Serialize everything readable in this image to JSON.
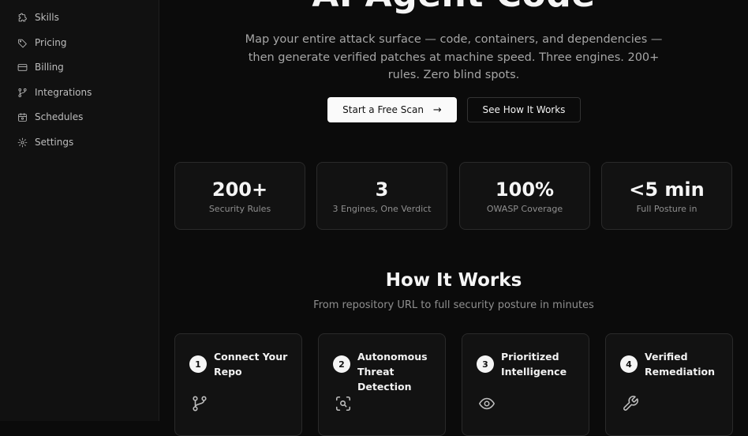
{
  "sidebar": {
    "items": [
      {
        "label": "Skills",
        "icon": "puzzle-icon"
      },
      {
        "label": "Pricing",
        "icon": "tag-icon"
      },
      {
        "label": "Billing",
        "icon": "credit-card-icon"
      },
      {
        "label": "Integrations",
        "icon": "git-branch-icon"
      },
      {
        "label": "Schedules",
        "icon": "calendar-icon"
      },
      {
        "label": "Settings",
        "icon": "gear-icon"
      }
    ]
  },
  "hero": {
    "title": "AI Agent Code",
    "subtitle": "Map your entire attack surface — code, containers, and dependencies — then generate verified patches at machine speed. Three engines. 200+ rules. Zero blind spots.",
    "primary_button": "Start a Free Scan",
    "secondary_button": "See How It Works"
  },
  "stats": [
    {
      "value": "200+",
      "label": "Security Rules"
    },
    {
      "value": "3",
      "label": "3 Engines, One Verdict"
    },
    {
      "value": "100%",
      "label": "OWASP Coverage"
    },
    {
      "value": "<5 min",
      "label": "Full Posture in"
    }
  ],
  "how_it_works": {
    "title": "How It Works",
    "subtitle": "From repository URL to full security posture in minutes",
    "steps": [
      {
        "number": "1",
        "title": "Connect Your Repo",
        "icon": "git-branch-icon"
      },
      {
        "number": "2",
        "title": "Autonomous Threat Detection",
        "icon": "scan-search-icon"
      },
      {
        "number": "3",
        "title": "Prioritized Intelligence",
        "icon": "eye-icon"
      },
      {
        "number": "4",
        "title": "Verified Remediation",
        "icon": "wrench-icon"
      }
    ]
  }
}
